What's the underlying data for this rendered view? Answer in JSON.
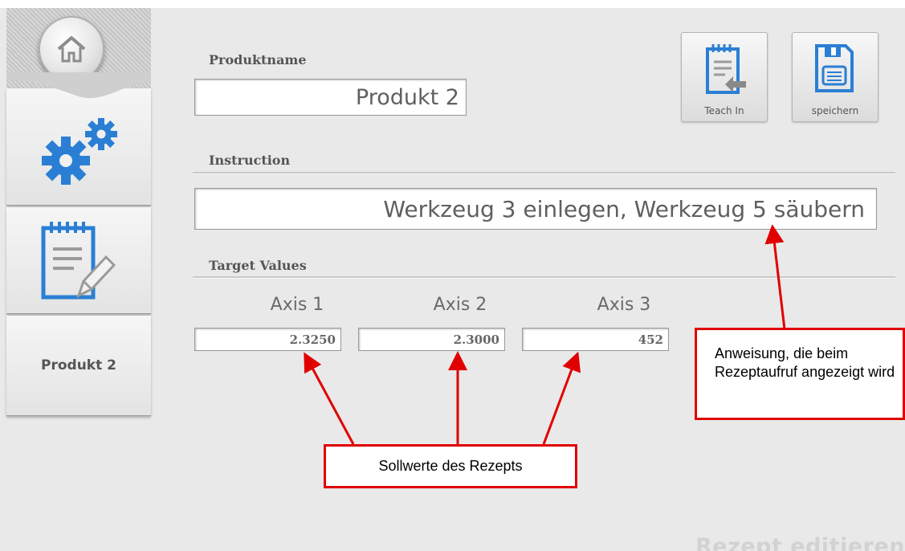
{
  "form": {
    "product_name_label": "Produktname",
    "product_name_value": "Produkt 2",
    "instruction_label": "Instruction",
    "instruction_value": "Werkzeug 3 einlegen, Werkzeug 5 säubern",
    "target_values_label": "Target Values",
    "axes": [
      {
        "label": "Axis 1",
        "value": "2.3250"
      },
      {
        "label": "Axis 2",
        "value": "2.3000"
      },
      {
        "label": "Axis 3",
        "value": "452"
      }
    ]
  },
  "toolbar": {
    "teach_in_label": "Teach In",
    "save_label": "speichern"
  },
  "sidebar": {
    "product_tab_label": "Produkt 2",
    "icons": [
      "home-icon",
      "gears-icon",
      "recipe-edit-icon"
    ]
  },
  "page_title": "Rezept editieren",
  "annotations": {
    "instruction_callout": "Anweisung, die beim Rezeptaufruf angezeigt wird",
    "target_callout": "Sollwerte des Rezepts"
  },
  "colors": {
    "accent_blue": "#2a7fd4",
    "annotation_red": "#e00000",
    "background": "#e9e9e9"
  }
}
